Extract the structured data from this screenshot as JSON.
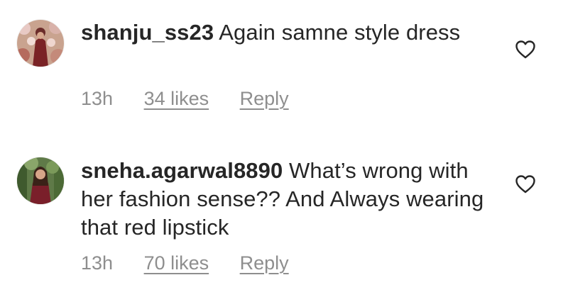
{
  "comments": [
    {
      "username": "shanju_ss23",
      "text": "Again samne style dress",
      "time": "13h",
      "likes": "34 likes",
      "reply": "Reply",
      "avatar_icon": "profile-avatar",
      "like_icon": "heart-outline-icon"
    },
    {
      "username": "sneha.agarwal8890",
      "text": "What’s wrong with her fashion sense?? And Always wearing that red lipstick",
      "time": "13h",
      "likes": "70 likes",
      "reply": "Reply",
      "avatar_icon": "profile-avatar",
      "like_icon": "heart-outline-icon"
    }
  ],
  "colors": {
    "text": "#262626",
    "secondary": "#8e8e8e",
    "background": "#ffffff"
  }
}
